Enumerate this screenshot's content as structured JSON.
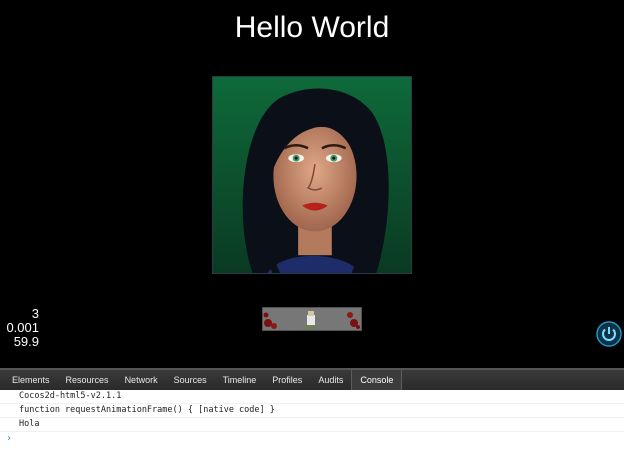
{
  "game": {
    "title": "Hello World",
    "stats": [
      "3",
      "0.001",
      "59.9"
    ]
  },
  "devtools": {
    "tabs": [
      "Elements",
      "Resources",
      "Network",
      "Sources",
      "Timeline",
      "Profiles",
      "Audits",
      "Console"
    ],
    "active_tab": "Console",
    "console_lines": [
      "Cocos2d-html5-v2.1.1",
      "function requestAnimationFrame() { [native code] }",
      "Hola"
    ],
    "prompt_symbol": "›"
  }
}
